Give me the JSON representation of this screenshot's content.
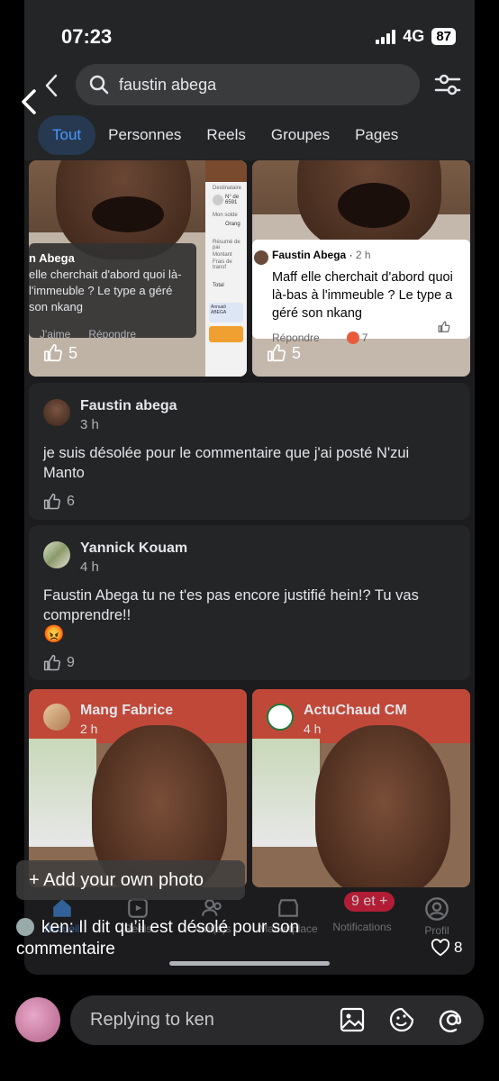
{
  "status_bar": {
    "time": "07:23",
    "network": "4G",
    "battery": "87"
  },
  "search": {
    "query": "faustin abega"
  },
  "tabs": [
    "Tout",
    "Personnes",
    "Reels",
    "Groupes",
    "Pages"
  ],
  "top_cards": [
    {
      "overlay_name": "n Abega",
      "overlay_text": "elle cherchait d'abord quoi là-l'immeuble ? Le type a géré son nkang",
      "overlay_actions": [
        "J'aime",
        "Répondre"
      ],
      "receipt_labels": [
        "Destinataire",
        "N° de",
        "6591",
        "Mon solde",
        "Orang",
        "Résumé de pai",
        "Montant",
        "Frais de transf",
        "Total",
        "Annuali",
        "ABEGA"
      ],
      "likes": "5"
    },
    {
      "overlay_name": "Faustin Abega",
      "overlay_time": "2 h",
      "overlay_text": "Maff elle cherchait d'abord quoi là-bas à l'immeuble ? Le type a géré son nkang",
      "overlay_reply": "Répondre",
      "overlay_reactions": "7",
      "likes": "5"
    }
  ],
  "comments": [
    {
      "name": "Faustin abega",
      "time": "3 h",
      "text": "je suis désolée pour le commentaire que j'ai posté N'zui Manto",
      "likes": "6"
    },
    {
      "name": "Yannick Kouam",
      "time": "4 h",
      "text": "Faustin Abega tu ne t'es pas encore justifié hein!? Tu vas comprendre!!",
      "emoji": "😡",
      "likes": "9"
    }
  ],
  "bottom_cards": [
    {
      "name": "Mang Fabrice",
      "time": "2 h"
    },
    {
      "name": "ActuChaud CM",
      "time": "4 h"
    }
  ],
  "nav": {
    "items": [
      "Accueil",
      "Reels",
      "Ami(e)s",
      "Marketplace",
      "Notifications",
      "Profil"
    ],
    "badge": "9 et +"
  },
  "story": {
    "add_photo": "+ Add your own photo",
    "reply_user": "ken",
    "reply_text": "ken: Il dit qu’il est désolé pour son commentaire",
    "likes": "8",
    "reply_placeholder": "Replying to ken"
  },
  "colors": {
    "accent": "#4599ff",
    "card_bg": "#242526",
    "badge": "#e41e3f"
  }
}
